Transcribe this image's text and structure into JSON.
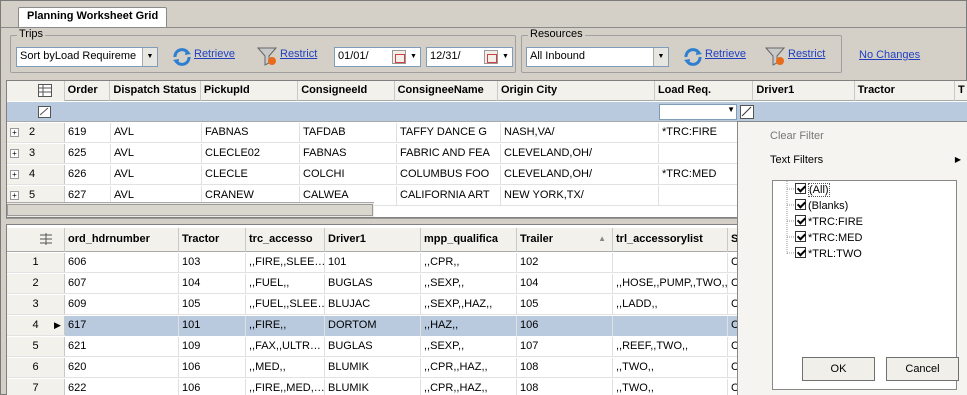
{
  "tab": {
    "label": "Planning Worksheet Grid"
  },
  "trips": {
    "group_label": "Trips",
    "sort_value": "Sort byLoad Requireme",
    "retrieve_label": "Retrieve",
    "restrict_label": "Restrict",
    "date_from": "01/01/",
    "date_to": "12/31/"
  },
  "resources": {
    "group_label": "Resources",
    "select_value": "All Inbound",
    "retrieve_label": "Retrieve",
    "restrict_label": "Restrict"
  },
  "no_changes_label": "No Changes",
  "trip_grid": {
    "columns": [
      "Order",
      "Dispatch Status",
      "PickupId",
      "ConsigneeId",
      "ConsigneeName",
      "Origin City",
      "Load Req.",
      "Driver1",
      "Tractor",
      "T"
    ],
    "rows": [
      {
        "num": "2",
        "cells": [
          "619",
          "AVL",
          "FABNAS",
          "TAFDAB",
          "TAFFY DANCE G",
          "NASH,VA/",
          "*TRC:FIRE"
        ]
      },
      {
        "num": "3",
        "cells": [
          "625",
          "AVL",
          "CLECLE02",
          "FABNAS",
          "FABRIC AND FEA",
          "CLEVELAND,OH/",
          ""
        ]
      },
      {
        "num": "4",
        "cells": [
          "626",
          "AVL",
          "CLECLE",
          "COLCHI",
          "COLUMBUS FOO",
          "CLEVELAND,OH/",
          "*TRC:MED"
        ]
      },
      {
        "num": "5",
        "cells": [
          "627",
          "AVL",
          "CRANEW",
          "CALWEA",
          "CALIFORNIA ART",
          "NEW YORK,TX/",
          ""
        ]
      }
    ]
  },
  "resource_grid": {
    "columns": [
      "ord_hdrnumber",
      "Tractor",
      "trc_accesso",
      "Driver1",
      "mpp_qualifica",
      "Trailer",
      "trl_accessorylist",
      "S"
    ],
    "rows": [
      {
        "num": "1",
        "cells": [
          "606",
          "103",
          ",,FIRE,,SLEE…",
          "101",
          ",,CPR,,",
          "102",
          "",
          "C"
        ]
      },
      {
        "num": "2",
        "cells": [
          "607",
          "104",
          ",,FUEL,,",
          "BUGLAS",
          ",,SEXP,,",
          "104",
          ",,HOSE,,PUMP,,TWO,,",
          "C"
        ]
      },
      {
        "num": "3",
        "cells": [
          "609",
          "105",
          ",,FUEL,,SLEE…",
          "BLUJAC",
          ",,SEXP,,HAZ,,",
          "105",
          ",,LADD,,",
          "C"
        ]
      },
      {
        "num": "4",
        "cells": [
          "617",
          "101",
          ",,FIRE,,",
          "DORTOM",
          ",,HAZ,,",
          "106",
          "",
          "C"
        ]
      },
      {
        "num": "5",
        "cells": [
          "621",
          "109",
          ",,FAX,,ULTR…",
          "BUGLAS",
          ",,SEXP,,",
          "107",
          ",,REEF,,TWO,,",
          "C"
        ]
      },
      {
        "num": "6",
        "cells": [
          "620",
          "106",
          ",,MED,,",
          "BLUMIK",
          ",,CPR,,HAZ,,",
          "108",
          ",,TWO,,",
          "C"
        ]
      },
      {
        "num": "7",
        "cells": [
          "622",
          "106",
          ",,FIRE,,MED,…",
          "BLUMIK",
          ",,CPR,,HAZ,,",
          "108",
          ",,TWO,,",
          "C"
        ]
      }
    ]
  },
  "filter_popup": {
    "clear_filter": "Clear Filter",
    "text_filters": "Text Filters",
    "items": [
      "(All)",
      "(Blanks)",
      "*TRC:FIRE",
      "*TRC:MED",
      "*TRL:TWO"
    ],
    "ok_label": "OK",
    "cancel_label": "Cancel"
  },
  "colors": {
    "selection": "#b9c9de",
    "link": "#1f3fc0",
    "window": "#d4d0c8"
  }
}
